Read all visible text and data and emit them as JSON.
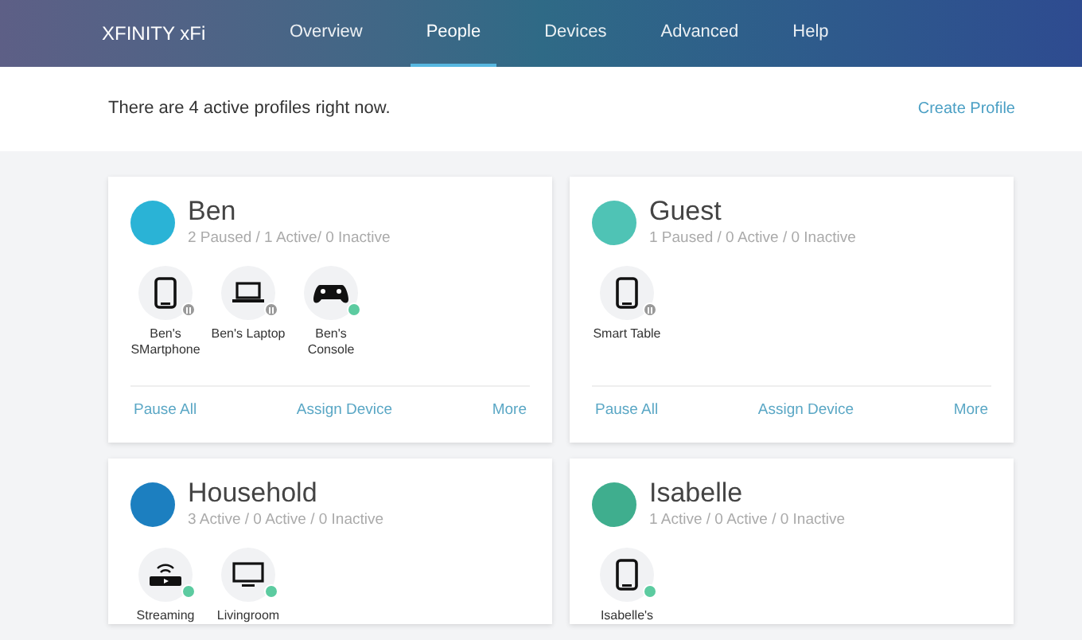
{
  "brand": "XFINITY xFi",
  "nav": [
    {
      "label": "Overview",
      "selected": false
    },
    {
      "label": "People",
      "selected": true
    },
    {
      "label": "Devices",
      "selected": false
    },
    {
      "label": "Advanced",
      "selected": false
    },
    {
      "label": "Help",
      "selected": false
    }
  ],
  "summary": "There are 4 active profiles right now.",
  "create_link": "Create Profile",
  "profiles": [
    {
      "name": "Ben",
      "color": "#2ab3d6",
      "counts": "2 Paused / 1 Active/ 0 Inactive",
      "devices": [
        {
          "kind": "phone",
          "label": "Ben's SMartphone",
          "paused": true
        },
        {
          "kind": "laptop",
          "label": "Ben's Laptop",
          "paused": true
        },
        {
          "kind": "console",
          "label": "Ben's Console",
          "paused": false
        }
      ],
      "actions": [
        "Pause All",
        "Assign Device",
        "More"
      ]
    },
    {
      "name": "Guest",
      "color": "#4fc3b5",
      "counts": "1 Paused / 0 Active / 0 Inactive",
      "devices": [
        {
          "kind": "phone",
          "label": "Smart Table",
          "paused": true
        }
      ],
      "actions": [
        "Pause All",
        "Assign Device",
        "More"
      ]
    },
    {
      "name": "Household",
      "color": "#1c7fc0",
      "counts": "3 Active / 0 Active / 0 Inactive",
      "devices": [
        {
          "kind": "streamer",
          "label": "Streaming",
          "paused": false
        },
        {
          "kind": "tv",
          "label": "Livingroom",
          "paused": false
        }
      ]
    },
    {
      "name": "Isabelle",
      "color": "#3fae8e",
      "counts": "1 Active / 0 Active / 0 Inactive",
      "devices": [
        {
          "kind": "phone",
          "label": "Isabelle's",
          "paused": false
        }
      ]
    }
  ]
}
